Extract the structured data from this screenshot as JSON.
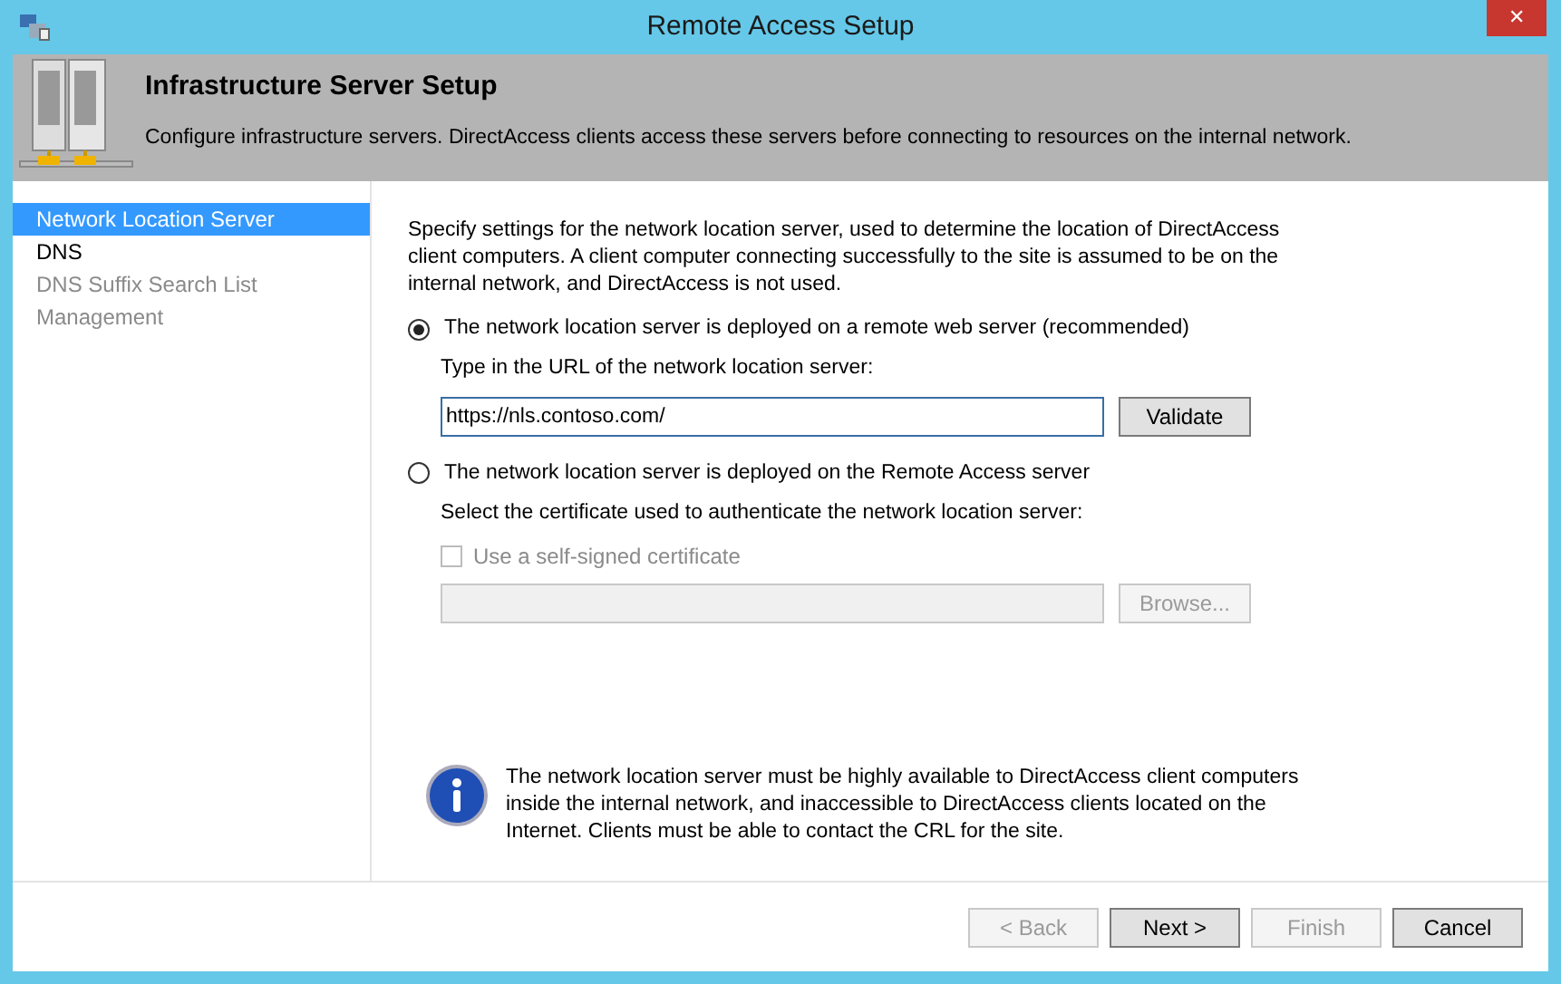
{
  "window": {
    "title": "Remote Access Setup",
    "close": "✕"
  },
  "header": {
    "title": "Infrastructure Server Setup",
    "description": "Configure infrastructure servers. DirectAccess clients access these servers before connecting to resources on the internal network."
  },
  "sidebar": {
    "items": [
      {
        "label": "Network Location Server",
        "selected": true,
        "disabled": false
      },
      {
        "label": "DNS",
        "selected": false,
        "disabled": false
      },
      {
        "label": "DNS Suffix Search List",
        "selected": false,
        "disabled": true
      },
      {
        "label": "Management",
        "selected": false,
        "disabled": true
      }
    ]
  },
  "intro": "Specify settings for the network location server, used to determine the location of DirectAccess client computers. A client computer connecting successfully to the site is assumed to be on the internal network, and DirectAccess is not used.",
  "options": [
    {
      "label": "The network location server is deployed on a remote web server (recommended)",
      "selected": true,
      "prompt": "Type in the URL of the network location server:",
      "field": {
        "value": "https://nls.contoso.com/",
        "disabled": false
      },
      "button": {
        "label": "Validate",
        "disabled": false
      }
    },
    {
      "label": "The network location server is deployed on the Remote Access server",
      "selected": false,
      "prompt": "Select the certificate used to authenticate the network location server:",
      "checkbox": {
        "label": "Use a self-signed certificate",
        "checked": false,
        "disabled": true
      },
      "field": {
        "disabled": true
      },
      "button": {
        "label": "Browse...",
        "disabled": true
      }
    }
  ],
  "info": "The network location server must be highly available to DirectAccess client computers inside the internal network, and inaccessible to DirectAccess clients located on the Internet. Clients must be able to contact the CRL for the site.",
  "footer_buttons": [
    {
      "label": "< Back",
      "disabled": true
    },
    {
      "label": "Next >",
      "disabled": false
    },
    {
      "label": "Finish",
      "disabled": true
    },
    {
      "label": "Cancel",
      "disabled": false
    }
  ]
}
